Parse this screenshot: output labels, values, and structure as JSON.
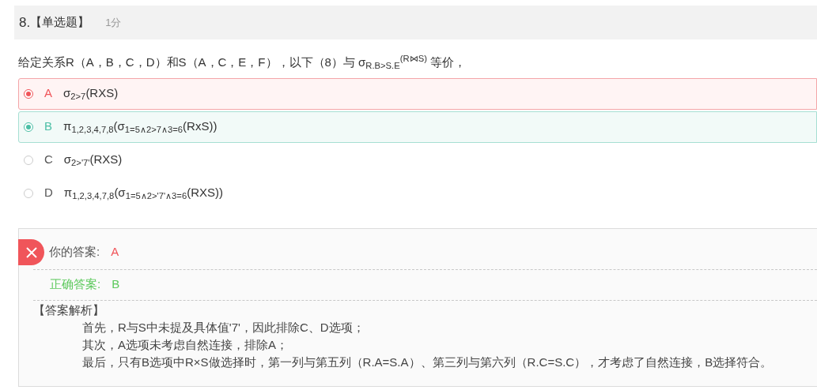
{
  "question": {
    "number": "8.",
    "type": "【单选题】",
    "score": "1分",
    "stem": "给定关系R（A，B，C，D）和S（A，C，E，F），以下（8）与 σ$_{R.B>S.E}$$^{(R⋈S)}$ 等价，"
  },
  "options": [
    {
      "letter": "A",
      "text": "σ$_{2>7}$(RXS)",
      "kind": "wrong"
    },
    {
      "letter": "B",
      "text": "π$_{1,2,3,4,7,8}$(σ$_{1=5∧2>7∧3=6}$(RxS))",
      "kind": "correct"
    },
    {
      "letter": "C",
      "text": "σ$_{2>'7'}$(RXS)",
      "kind": "plain"
    },
    {
      "letter": "D",
      "text": "π$_{1,2,3,4,7,8}$(σ$_{1=5∧2>'7'∧3=6}$(RXS))",
      "kind": "plain"
    }
  ],
  "result": {
    "is_correct": false,
    "your_label": "你的答案:",
    "your_answer": "A",
    "correct_label": "正确答案:",
    "correct_answer": "B",
    "analysis_title": "【答案解析】",
    "analysis_lines": [
      "首先，R与S中未提及具体值'7'，因此排除C、D选项；",
      "其次，A选项未考虑自然连接，排除A；",
      "最后，只有B选项中R×S做选择时，第一列与第五列（R.A=S.A）、第三列与第六列（R.C=S.C），才考虑了自然连接，B选择符合。"
    ]
  }
}
